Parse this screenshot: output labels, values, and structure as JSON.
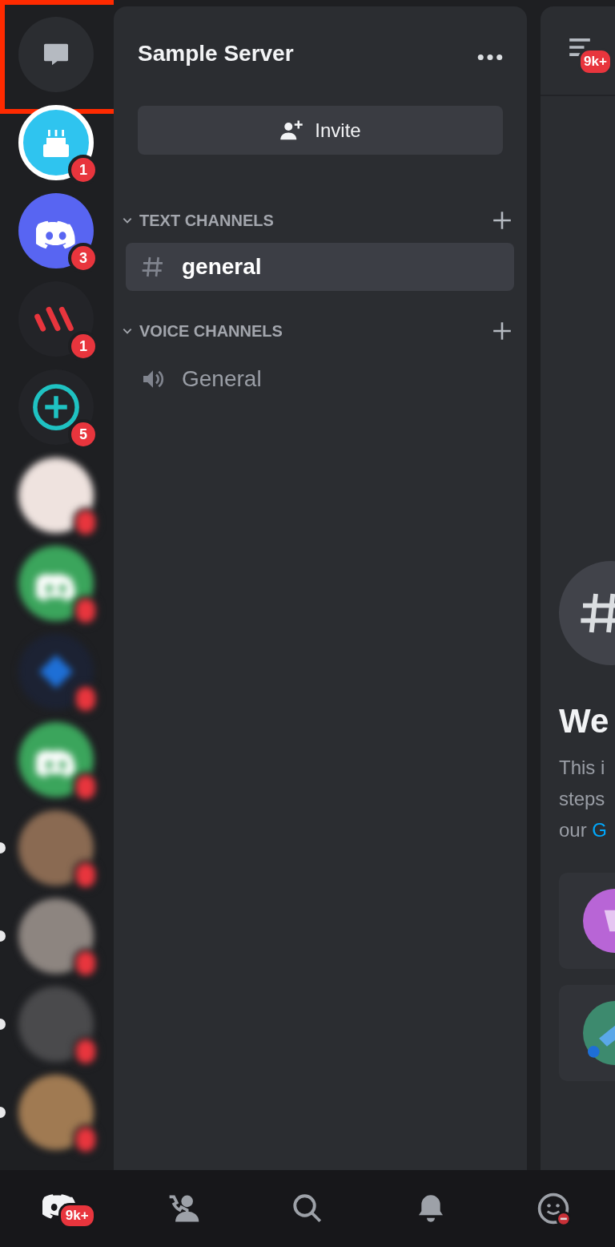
{
  "servers": [
    {
      "kind": "dm",
      "color": "#2b2d31",
      "unread": false,
      "blurred": false,
      "highlighted": true
    },
    {
      "kind": "cake",
      "color": "#2fc4ef",
      "badge": "1",
      "unread": false,
      "blurred": false,
      "highlighted": false
    },
    {
      "kind": "discord",
      "color": "#5865f2",
      "badge": "3",
      "unread": false,
      "blurred": false,
      "highlighted": false
    },
    {
      "kind": "slashes",
      "color": "#232428",
      "badge": "1",
      "unread": false,
      "blurred": false,
      "highlighted": false
    },
    {
      "kind": "plus",
      "color": "#232428",
      "badge": "5",
      "unread": false,
      "blurred": false,
      "highlighted": false
    },
    {
      "kind": "photo",
      "color": "#efe3df",
      "has_badge": true,
      "unread": false,
      "blurred": true,
      "highlighted": false
    },
    {
      "kind": "discord",
      "color": "#3ba55c",
      "has_badge": true,
      "unread": false,
      "blurred": true,
      "highlighted": false
    },
    {
      "kind": "diamond",
      "color": "#1c2233",
      "has_badge": true,
      "unread": false,
      "blurred": true,
      "highlighted": false
    },
    {
      "kind": "discord",
      "color": "#3ba55c",
      "has_badge": true,
      "unread": false,
      "blurred": true,
      "highlighted": false
    },
    {
      "kind": "photo",
      "color": "#8a6a52",
      "has_badge": true,
      "unread": true,
      "blurred": true,
      "highlighted": false
    },
    {
      "kind": "photo",
      "color": "#8d8580",
      "has_badge": true,
      "unread": true,
      "blurred": true,
      "highlighted": false
    },
    {
      "kind": "photo",
      "color": "#4a4a4c",
      "has_badge": true,
      "unread": true,
      "blurred": true,
      "highlighted": false
    },
    {
      "kind": "photo",
      "color": "#a07a52",
      "has_badge": true,
      "unread": true,
      "blurred": true,
      "highlighted": false
    }
  ],
  "server": {
    "name": "Sample Server",
    "invite": "Invite"
  },
  "categories": [
    {
      "name": "TEXT CHANNELS",
      "expanded": true,
      "channels": [
        {
          "kind": "text",
          "name": "general",
          "selected": true
        }
      ]
    },
    {
      "name": "VOICE CHANNELS",
      "expanded": true,
      "channels": [
        {
          "kind": "voice",
          "name": "General",
          "selected": false
        }
      ]
    }
  ],
  "chat": {
    "header_badge": "9k+",
    "heading": "We",
    "lines": [
      "This i",
      "steps"
    ],
    "last_line": "our ",
    "link": "G"
  },
  "nav": [
    {
      "kind": "home",
      "badge": "9k+",
      "selected": true
    },
    {
      "kind": "friends",
      "selected": false
    },
    {
      "kind": "search",
      "selected": false
    },
    {
      "kind": "bell",
      "selected": false
    },
    {
      "kind": "profile",
      "selected": false
    }
  ]
}
